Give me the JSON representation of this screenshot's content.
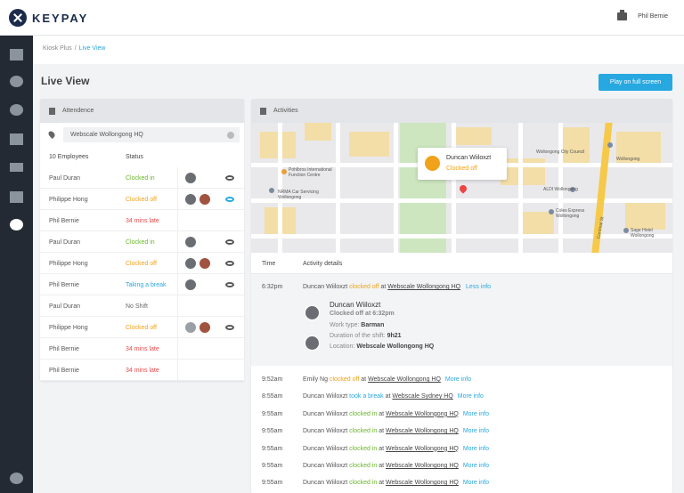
{
  "app": {
    "logo_text": "KEYPAY",
    "user": "Phil Bernie"
  },
  "breadcrumb": {
    "parent": "Kiosk Plus",
    "sep": "/",
    "current": "Live View"
  },
  "page": {
    "title": "Live View",
    "play_button": "Play on full screen"
  },
  "attendance": {
    "panel_title": "Attendence",
    "search_value": "Webscale Wollongong HQ",
    "col_employees": "10 Employees",
    "col_status": "Status",
    "rows": [
      {
        "name": "Paul Duran",
        "status": "Clocked in",
        "tone": "green",
        "avatars": 1,
        "eye": true
      },
      {
        "name": "Philippe Hong",
        "status": "Clocked off",
        "tone": "orange",
        "avatars": 2,
        "eye": true,
        "highlight": true
      },
      {
        "name": "Phil Bernie",
        "status": "34 mins late",
        "tone": "red",
        "avatars": 0,
        "eye": false
      },
      {
        "name": "Paul Duran",
        "status": "Clocked in",
        "tone": "green",
        "avatars": 1,
        "eye": true
      },
      {
        "name": "Philippe Hong",
        "status": "Clocked off",
        "tone": "orange",
        "avatars": 2,
        "eye": true
      },
      {
        "name": "Phil Bernie",
        "status": "Taking a break",
        "tone": "blue",
        "avatars": 1,
        "eye": true
      },
      {
        "name": "Paul Duran",
        "status": "No Shift",
        "tone": "grey",
        "avatars": 0,
        "eye": false
      },
      {
        "name": "Philippe Hong",
        "status": "Clocked off",
        "tone": "orange",
        "avatars": 2,
        "eye": true
      },
      {
        "name": "Phil Bernie",
        "status": "34 mins late",
        "tone": "red",
        "avatars": 0,
        "eye": false
      },
      {
        "name": "Phil Bernie",
        "status": "34 mins late",
        "tone": "red",
        "avatars": 0,
        "eye": false
      }
    ]
  },
  "activities": {
    "panel_title": "Activities",
    "map_labels": {
      "l1": "Pohlbros International Function Centre",
      "l2": "NRMA Car Servicing Wollongong",
      "l3": "Wollongong City Council",
      "l4": "Wollongong",
      "l5": "ALDI Wollongong",
      "l6": "Coles Express Wollongong",
      "l7": "Sage Hotel Wollongong",
      "l8": "Corrimal St"
    },
    "popup": {
      "name": "Duncan Wiiloxzt",
      "status": "Clocked off"
    },
    "col_time": "Time",
    "col_details": "Activity details",
    "expanded": {
      "time": "6:32pm",
      "who": "Duncan Wiiloxzt",
      "action": "clocked off",
      "at": "at",
      "location": "Webscale Wollongong HQ",
      "link": "Less info",
      "detail_name": "Duncan Wiiloxzt",
      "detail_status": "Clocked off at 6:32pm",
      "work_type_label": "Work type:",
      "work_type": "Barman",
      "duration_label": "Duration of the shift:",
      "duration": "9h21",
      "location_label": "Location:",
      "location_value": "Webscale Wollongong HQ"
    },
    "entries": [
      {
        "time": "9:52am",
        "who": "Emily Ng",
        "action": "clocked off",
        "tone": "orange",
        "location": "Webscale Wollongong HQ",
        "link": "More info"
      },
      {
        "time": "8:55am",
        "who": "Duncan Wiiloxzt",
        "action": "took a break",
        "tone": "blue",
        "location": "Webscale Sydney HQ",
        "link": "More info"
      },
      {
        "time": "9:55am",
        "who": "Duncan Wiiloxzt",
        "action": "clocked in",
        "tone": "green",
        "location": "Webscale Wollongong HQ",
        "link": "More info"
      },
      {
        "time": "9:55am",
        "who": "Duncan Wiiloxzt",
        "action": "clocked in",
        "tone": "green",
        "location": "Webscale Wollongong HQ",
        "link": "More info"
      },
      {
        "time": "9:55am",
        "who": "Duncan Wiiloxzt",
        "action": "clocked in",
        "tone": "green",
        "location": "Webscale Wollongong HQ",
        "link": "More info"
      },
      {
        "time": "9:55am",
        "who": "Duncan Wiiloxzt",
        "action": "clocked in",
        "tone": "green",
        "location": "Webscale Wollongong HQ",
        "link": "More info"
      },
      {
        "time": "9:55am",
        "who": "Duncan Wiiloxzt",
        "action": "clocked in",
        "tone": "green",
        "location": "Webscale Wollongong HQ",
        "link": "More info"
      }
    ],
    "at_word": "at"
  },
  "icons": {
    "sidebar": [
      "home-icon",
      "user-icon",
      "money-icon",
      "folder-icon",
      "plane-icon",
      "calendar-icon",
      "info-icon",
      "help-icon"
    ],
    "printer": "printer-icon"
  },
  "colors": {
    "accent": "#27a8e0",
    "green": "#6bb52d",
    "orange": "#f0a21a",
    "red": "#e94a4a",
    "sidebar": "#232a33"
  }
}
